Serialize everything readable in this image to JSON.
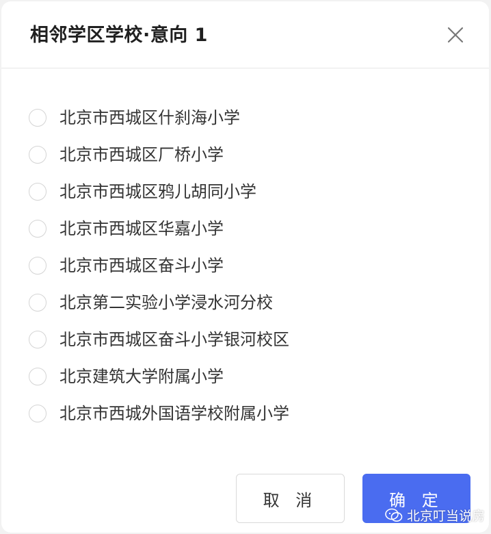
{
  "dialog": {
    "title": "相邻学区学校·意向 1",
    "close_icon": "close-icon"
  },
  "options": [
    {
      "label": "北京市西城区什刹海小学",
      "selected": false
    },
    {
      "label": "北京市西城区厂桥小学",
      "selected": false
    },
    {
      "label": "北京市西城区鸦儿胡同小学",
      "selected": false
    },
    {
      "label": "北京市西城区华嘉小学",
      "selected": false
    },
    {
      "label": "北京市西城区奋斗小学",
      "selected": false
    },
    {
      "label": "北京第二实验小学浸水河分校",
      "selected": false
    },
    {
      "label": "北京市西城区奋斗小学银河校区",
      "selected": false
    },
    {
      "label": "北京建筑大学附属小学",
      "selected": false
    },
    {
      "label": "北京市西城外国语学校附属小学",
      "selected": false
    }
  ],
  "buttons": {
    "cancel_label": "取 消",
    "ok_label": "确 定"
  },
  "watermark": {
    "text": "北京叮当说房",
    "icon": "wechat-icon"
  },
  "colors": {
    "primary": "#4a6cf0",
    "radio_border": "#d4d4d4",
    "text": "#333333"
  }
}
